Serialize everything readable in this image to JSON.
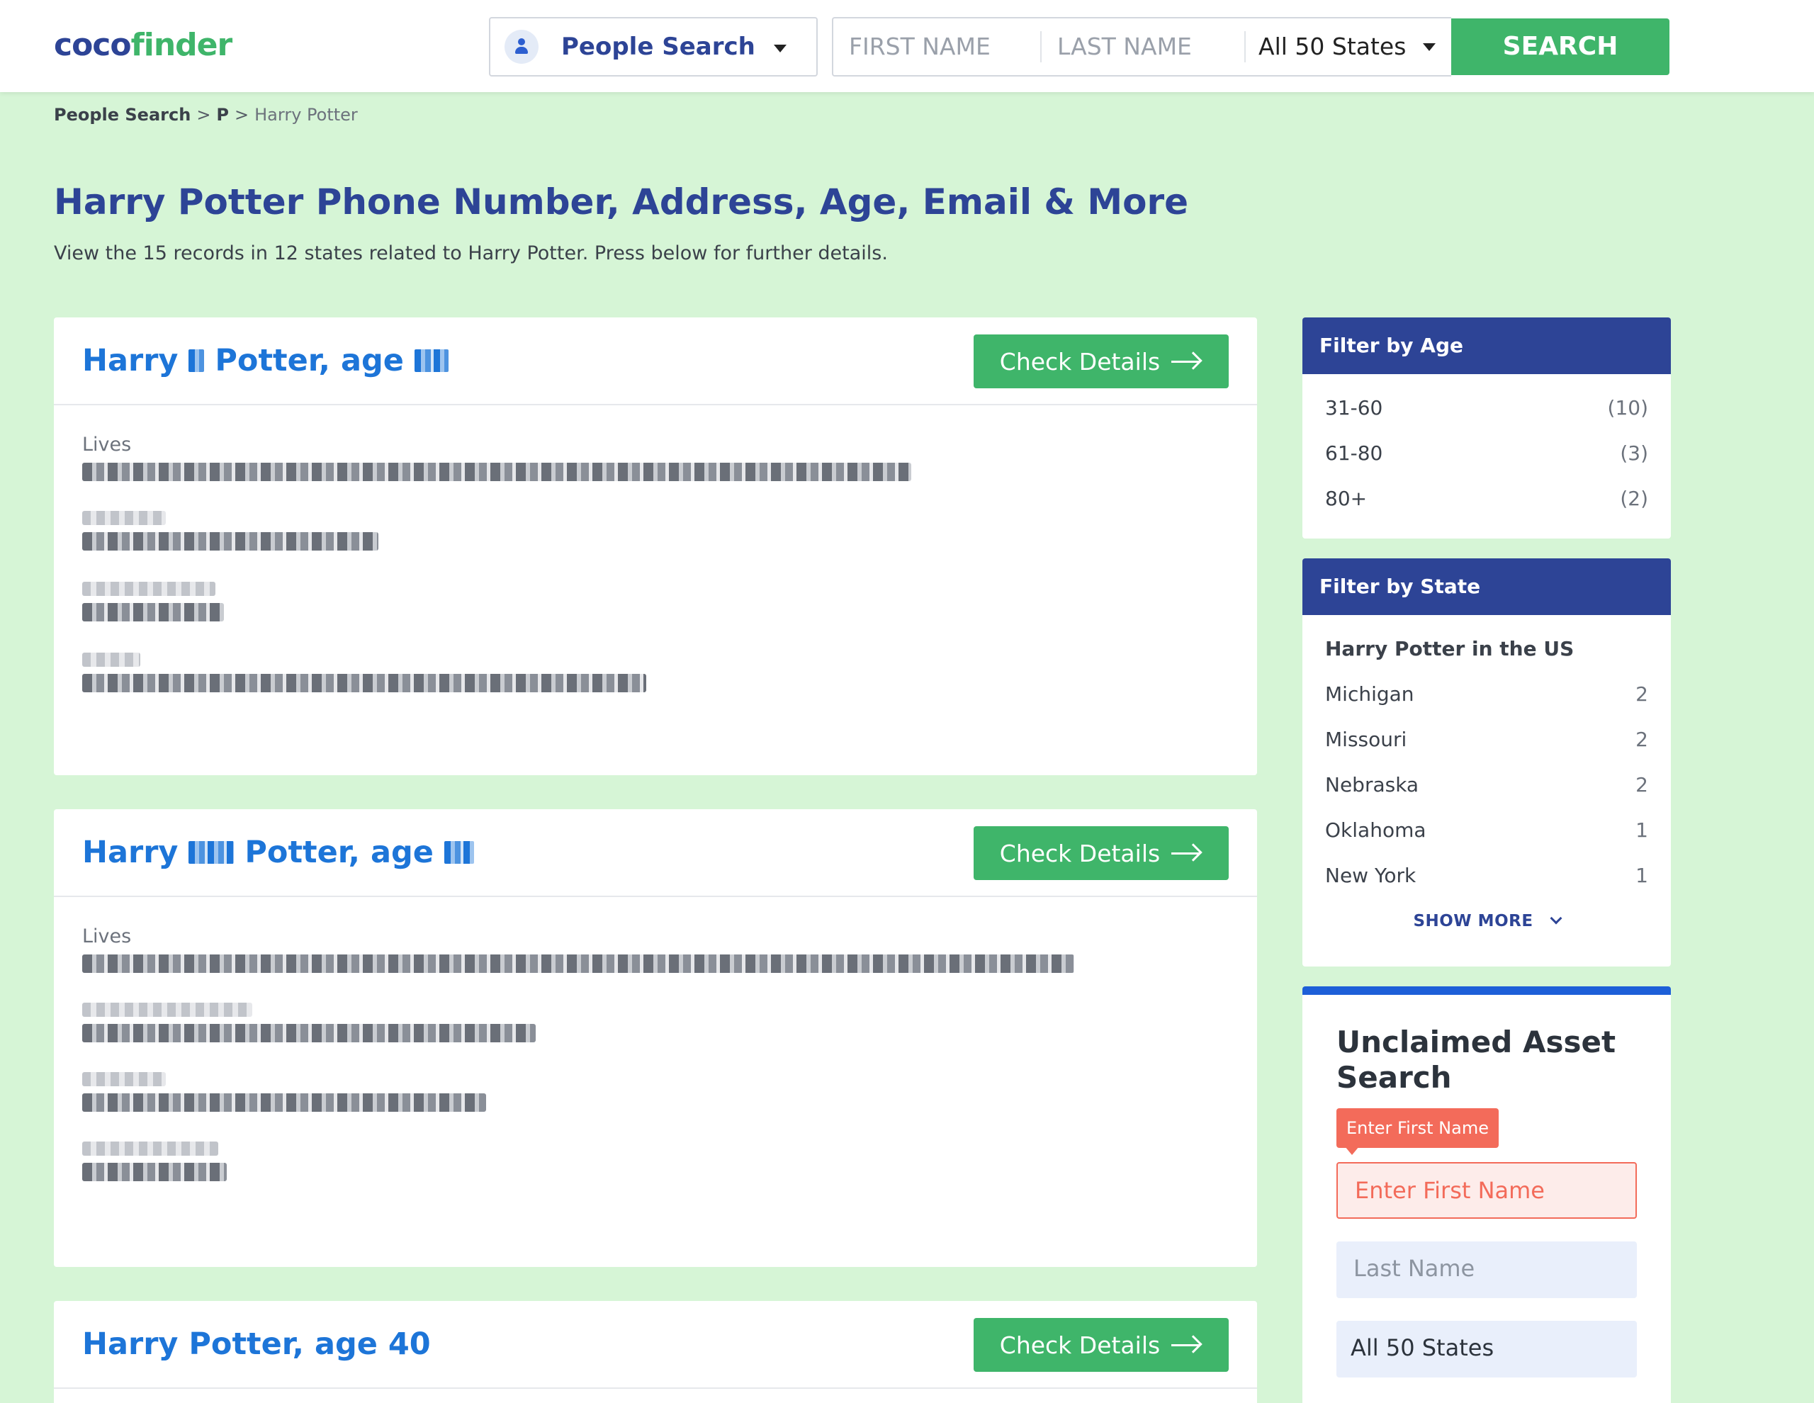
{
  "header": {
    "logo_part1": "coco",
    "logo_part2": "finder",
    "search_type": "People Search",
    "first_name_placeholder": "FIRST NAME",
    "last_name_placeholder": "LAST NAME",
    "state_value": "All 50 States",
    "search_label": "SEARCH"
  },
  "breadcrumb": {
    "item1": "People Search",
    "item2": "P",
    "item3": "Harry Potter",
    "sep": ">"
  },
  "page": {
    "title_bold": "Harry Potter",
    "title_rest": " Phone Number, Address, Age, Email & More",
    "subtitle": "View the 15 records in 12 states related to Harry Potter. Press below for further details."
  },
  "results": [
    {
      "name_first": "Harry",
      "name_last": "Potter, age",
      "age": "",
      "lives_label": "Lives",
      "check_label": "Check Details"
    },
    {
      "name_first": "Harry",
      "name_last": "Potter, age",
      "age": "",
      "lives_label": "Lives",
      "check_label": "Check Details"
    },
    {
      "name_first": "Harry",
      "name_last": "Potter, age",
      "age": "40",
      "title_full": "Harry Potter, age 40",
      "check_label": "Check Details"
    }
  ],
  "filter_age": {
    "title": "Filter by Age",
    "items": [
      {
        "label": "31-60",
        "count": "(10)"
      },
      {
        "label": "61-80",
        "count": "(3)"
      },
      {
        "label": "80+",
        "count": "(2)"
      }
    ]
  },
  "filter_state": {
    "title": "Filter by State",
    "subtitle": "Harry Potter in the US",
    "items": [
      {
        "label": "Michigan",
        "count": "2"
      },
      {
        "label": "Missouri",
        "count": "2"
      },
      {
        "label": "Nebraska",
        "count": "2"
      },
      {
        "label": "Oklahoma",
        "count": "1"
      },
      {
        "label": "New York",
        "count": "1"
      }
    ],
    "show_more": "SHOW MORE"
  },
  "asset_search": {
    "title": "Unclaimed Asset Search",
    "tooltip": "Enter First Name",
    "first_name_placeholder": "Enter First Name",
    "last_name_placeholder": "Last Name",
    "state_value": "All 50 States"
  },
  "colors": {
    "brand_blue": "#2d4496",
    "brand_green": "#3fb56a",
    "page_bg": "#d6f5d6",
    "link_blue": "#1d75d8",
    "error_red": "#f36b5a"
  }
}
